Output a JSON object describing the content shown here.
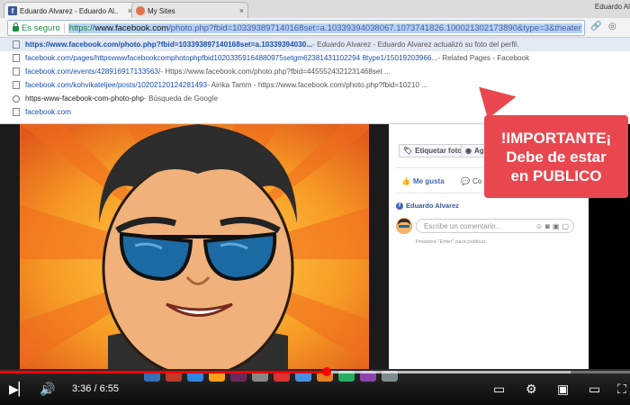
{
  "browser": {
    "tabs": [
      {
        "label": "Eduardo Alvarez - Eduardo Al..",
        "active": true
      },
      {
        "label": "My Sites",
        "active": false
      }
    ],
    "profile_name": "Eduardo Al",
    "address": {
      "secure_label": "Es seguro",
      "url_protocol": "https://",
      "url_domain": "www.facebook.com",
      "url_path": "/photo.php?fbid=103393897140168set=a.10339394038067.1073741826.100021302173890&type=3&theater"
    },
    "suggestions": [
      {
        "type": "page",
        "link": "https://www.facebook.com/photo.php?fbid=103393897140168set=a.10339394030...",
        "desc": " - Eduardo Alvarez - Eduardo Alvarez actualizó su foto del perfil.",
        "selected": true
      },
      {
        "type": "page",
        "link": "facebook.com/pages/httpswwwfacebookcomphotophpfbid10203359164880975setgm62381431102294 8type1/15019203966...",
        "desc": " - Related Pages - Facebook",
        "selected": false
      },
      {
        "type": "page",
        "link": "facebook.com/events/428916917133563/",
        "desc": " - Https://www.facebook.com/photo.php?fbid=4455524321231468set ...",
        "selected": false
      },
      {
        "type": "page",
        "link": "facebook.com/kohvikateljee/posts/10202120124281493",
        "desc": " - Airika Tamm - https://www.facebook.com/photo.php?fbid=10210 ...",
        "selected": false
      },
      {
        "type": "search",
        "link": "https-www-facebook-com-photo-php",
        "desc": " - Búsqueda de Google",
        "selected": false
      },
      {
        "type": "page",
        "link": "facebook.com",
        "desc": "",
        "selected": false
      }
    ]
  },
  "facebook": {
    "tag_button": "Etiquetar foto",
    "add_button": "Ag",
    "like_button": "Me gusta",
    "comment_button": "Co",
    "uploader": "Eduardo Alvarez",
    "comment_placeholder": "Escribe un comentario...",
    "comment_hint": "Presiona \"Enter\" para publicar."
  },
  "banner": {
    "line1": "!IMPORTANTE¡",
    "line2": "Debe de estar",
    "line3": "en PUBLICO"
  },
  "video": {
    "current_time": "3:36",
    "total_time": "6:55",
    "time_display": "3:36 / 6:55",
    "progress_fraction": 0.519,
    "buffered_fraction": 0.905,
    "progress_color": "#ff0000"
  },
  "colors": {
    "facebook_blue": "#4267b2",
    "banner_red": "#e9474f",
    "secure_green": "#1e8e3e"
  }
}
